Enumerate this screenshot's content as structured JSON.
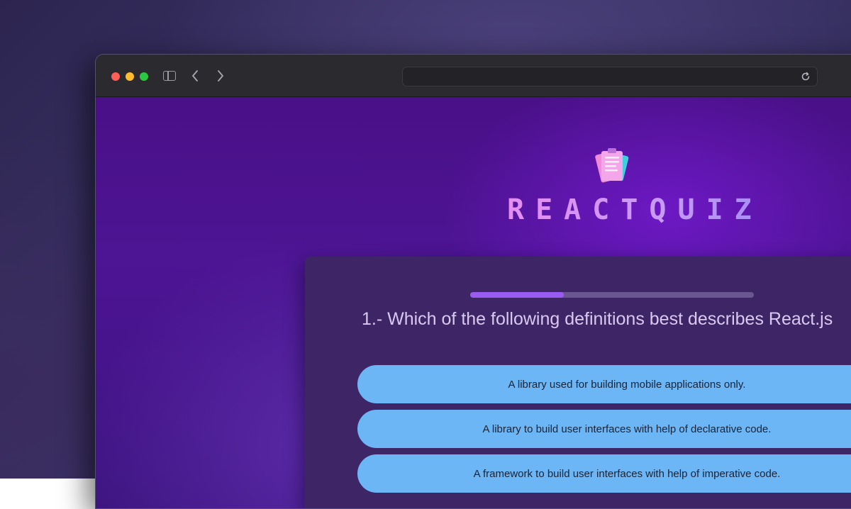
{
  "browser": {
    "address_bar": {
      "value": ""
    }
  },
  "app": {
    "title": "REACTQUIZ",
    "logo_icon": "clipboard-icon"
  },
  "quiz": {
    "progress": 0.33,
    "question": "1.- Which of the following definitions best describes React.js",
    "options": [
      {
        "label": "A library used for building mobile applications only."
      },
      {
        "label": "A library to build user interfaces with help of declarative code."
      },
      {
        "label": "A framework to build user interfaces with help of imperative code."
      }
    ]
  },
  "colors": {
    "accent": "#9a5cf0",
    "option_bg": "#6cb6f5",
    "title_gradient_start": "#e68ef2",
    "title_gradient_end": "#a88cf7",
    "background": "#4a1088"
  }
}
